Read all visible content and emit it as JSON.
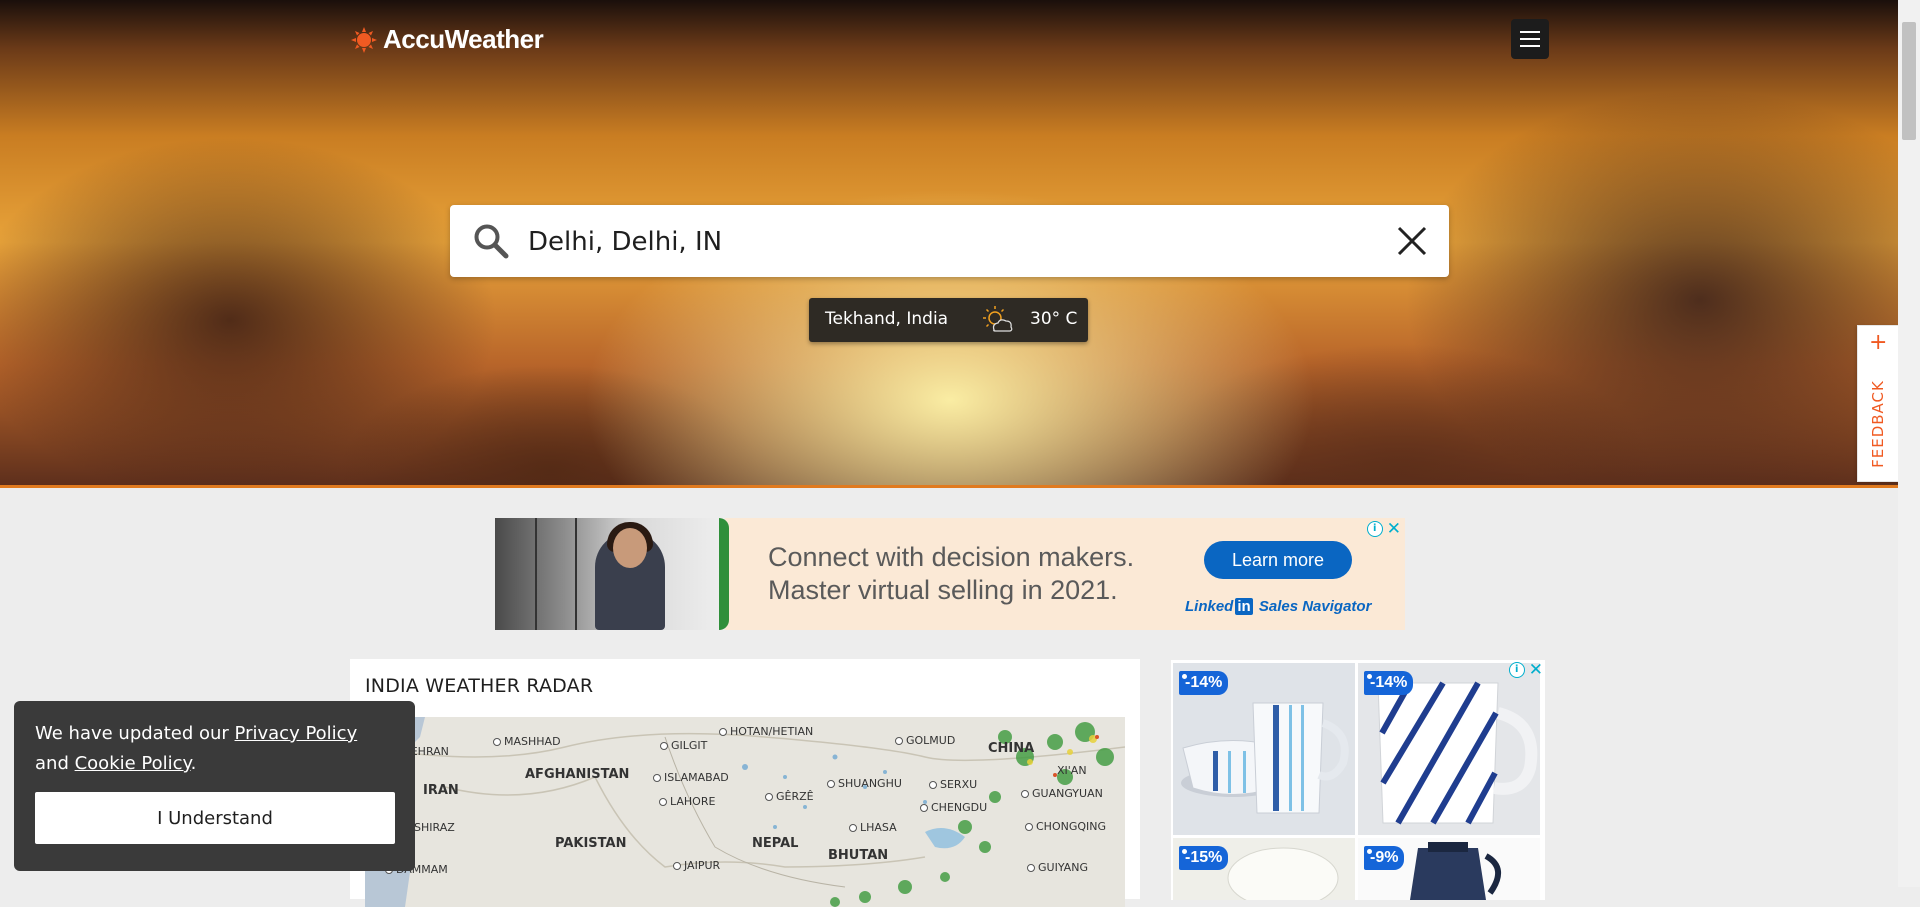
{
  "header": {
    "brand": "AccuWeather",
    "menu_icon": "hamburger-menu-icon"
  },
  "search": {
    "value": "Delhi, Delhi, IN",
    "icon": "search-icon",
    "clear_icon": "close-icon"
  },
  "recent_location": {
    "name": "Tekhand, India",
    "temperature": "30° C",
    "condition_icon": "partly-cloudy-icon"
  },
  "feedback": {
    "label": "FEEDBACK",
    "plus": "+"
  },
  "banner_ad": {
    "line1": "Connect with decision makers.",
    "line2": "Master virtual selling in 2021.",
    "cta": "Learn more",
    "brand_prefix": "Linked",
    "brand_box": "in",
    "brand_suffix": "Sales Navigator"
  },
  "radar": {
    "title": "INDIA WEATHER RADAR",
    "labels": {
      "tehran": "TEHRAN",
      "mashhad": "MASHHAD",
      "iran": "IRAN",
      "afghanistan": "AFGHANISTAN",
      "gilgit": "GILGIT",
      "hotan": "HOTAN/HETIAN",
      "golmud": "GOLMUD",
      "china": "CHINA",
      "xian": "XI'AN",
      "islamabad": "ISLAMABAD",
      "gerze": "GÊRZÊ",
      "shuanghu": "SHUANGHU",
      "serxu": "SERXU",
      "guangyuan": "GUANGYUAN",
      "lahore": "LAHORE",
      "chengdu": "CHENGDU",
      "shiraz": "SHIRAZ",
      "pakistan": "PAKISTAN",
      "nepal": "NEPAL",
      "lhasa": "LHASA",
      "chongqing": "CHONGQING",
      "bhutan": "BHUTAN",
      "dammam": "DAMMAM",
      "jaipur": "JAIPUR",
      "guiyang": "GUIYANG"
    }
  },
  "side_ad": {
    "products": [
      {
        "discount": "-14%"
      },
      {
        "discount": "-14%"
      },
      {
        "discount": "-15%"
      },
      {
        "discount": "-9%"
      }
    ]
  },
  "cookie_banner": {
    "text_before": "We have updated our ",
    "privacy_link": "Privacy Policy",
    "text_middle": " and ",
    "cookie_link": "Cookie Policy",
    "text_after": ".",
    "button": "I Understand"
  },
  "colors": {
    "accent": "#f05a22",
    "linkedin_blue": "#0a66c2",
    "discount_tag": "#1565d8",
    "cookie_bg": "#3a3a3a"
  }
}
